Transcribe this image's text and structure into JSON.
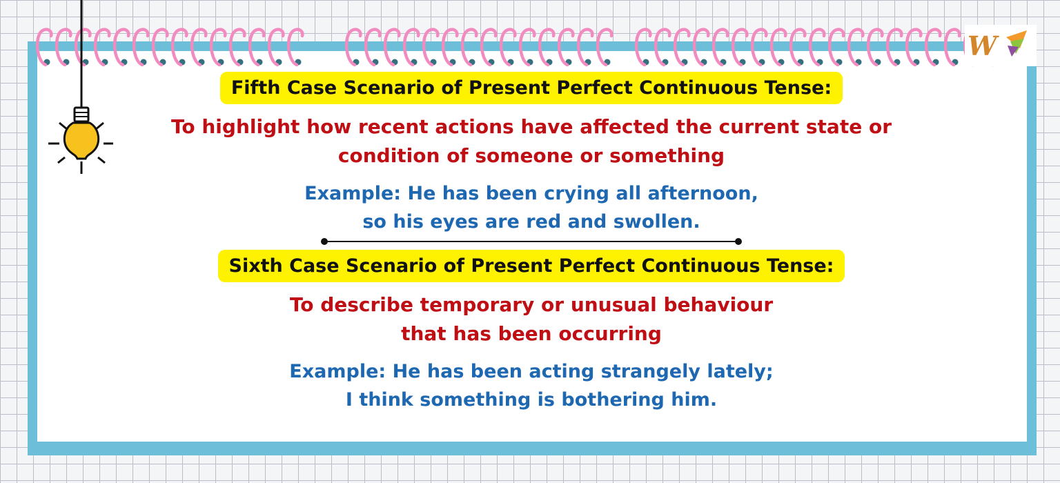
{
  "scenario_5": {
    "heading": "Fifth Case Scenario of Present Perfect Continuous Tense:",
    "description_lines": [
      "To highlight how recent actions have affected the current state or",
      "condition of someone or something"
    ],
    "example_lines": [
      "Example: He has been crying all afternoon,",
      "so his eyes are red and swollen."
    ]
  },
  "scenario_6": {
    "heading": "Sixth Case Scenario of Present Perfect Continuous Tense:",
    "description_lines": [
      "To describe temporary or unusual behaviour",
      "that has been occurring"
    ],
    "example_lines": [
      "Example: He has been acting strangely lately;",
      "I think something is bothering him."
    ]
  },
  "logo": {
    "icon": "w-logo-icon",
    "letter": "W"
  },
  "colors": {
    "heading_highlight": "#fff200",
    "description_text": "#c00f14",
    "example_text": "#1e67b1",
    "notebook_border": "#6dbfd9",
    "spiral_rings": "#f28bbf"
  }
}
